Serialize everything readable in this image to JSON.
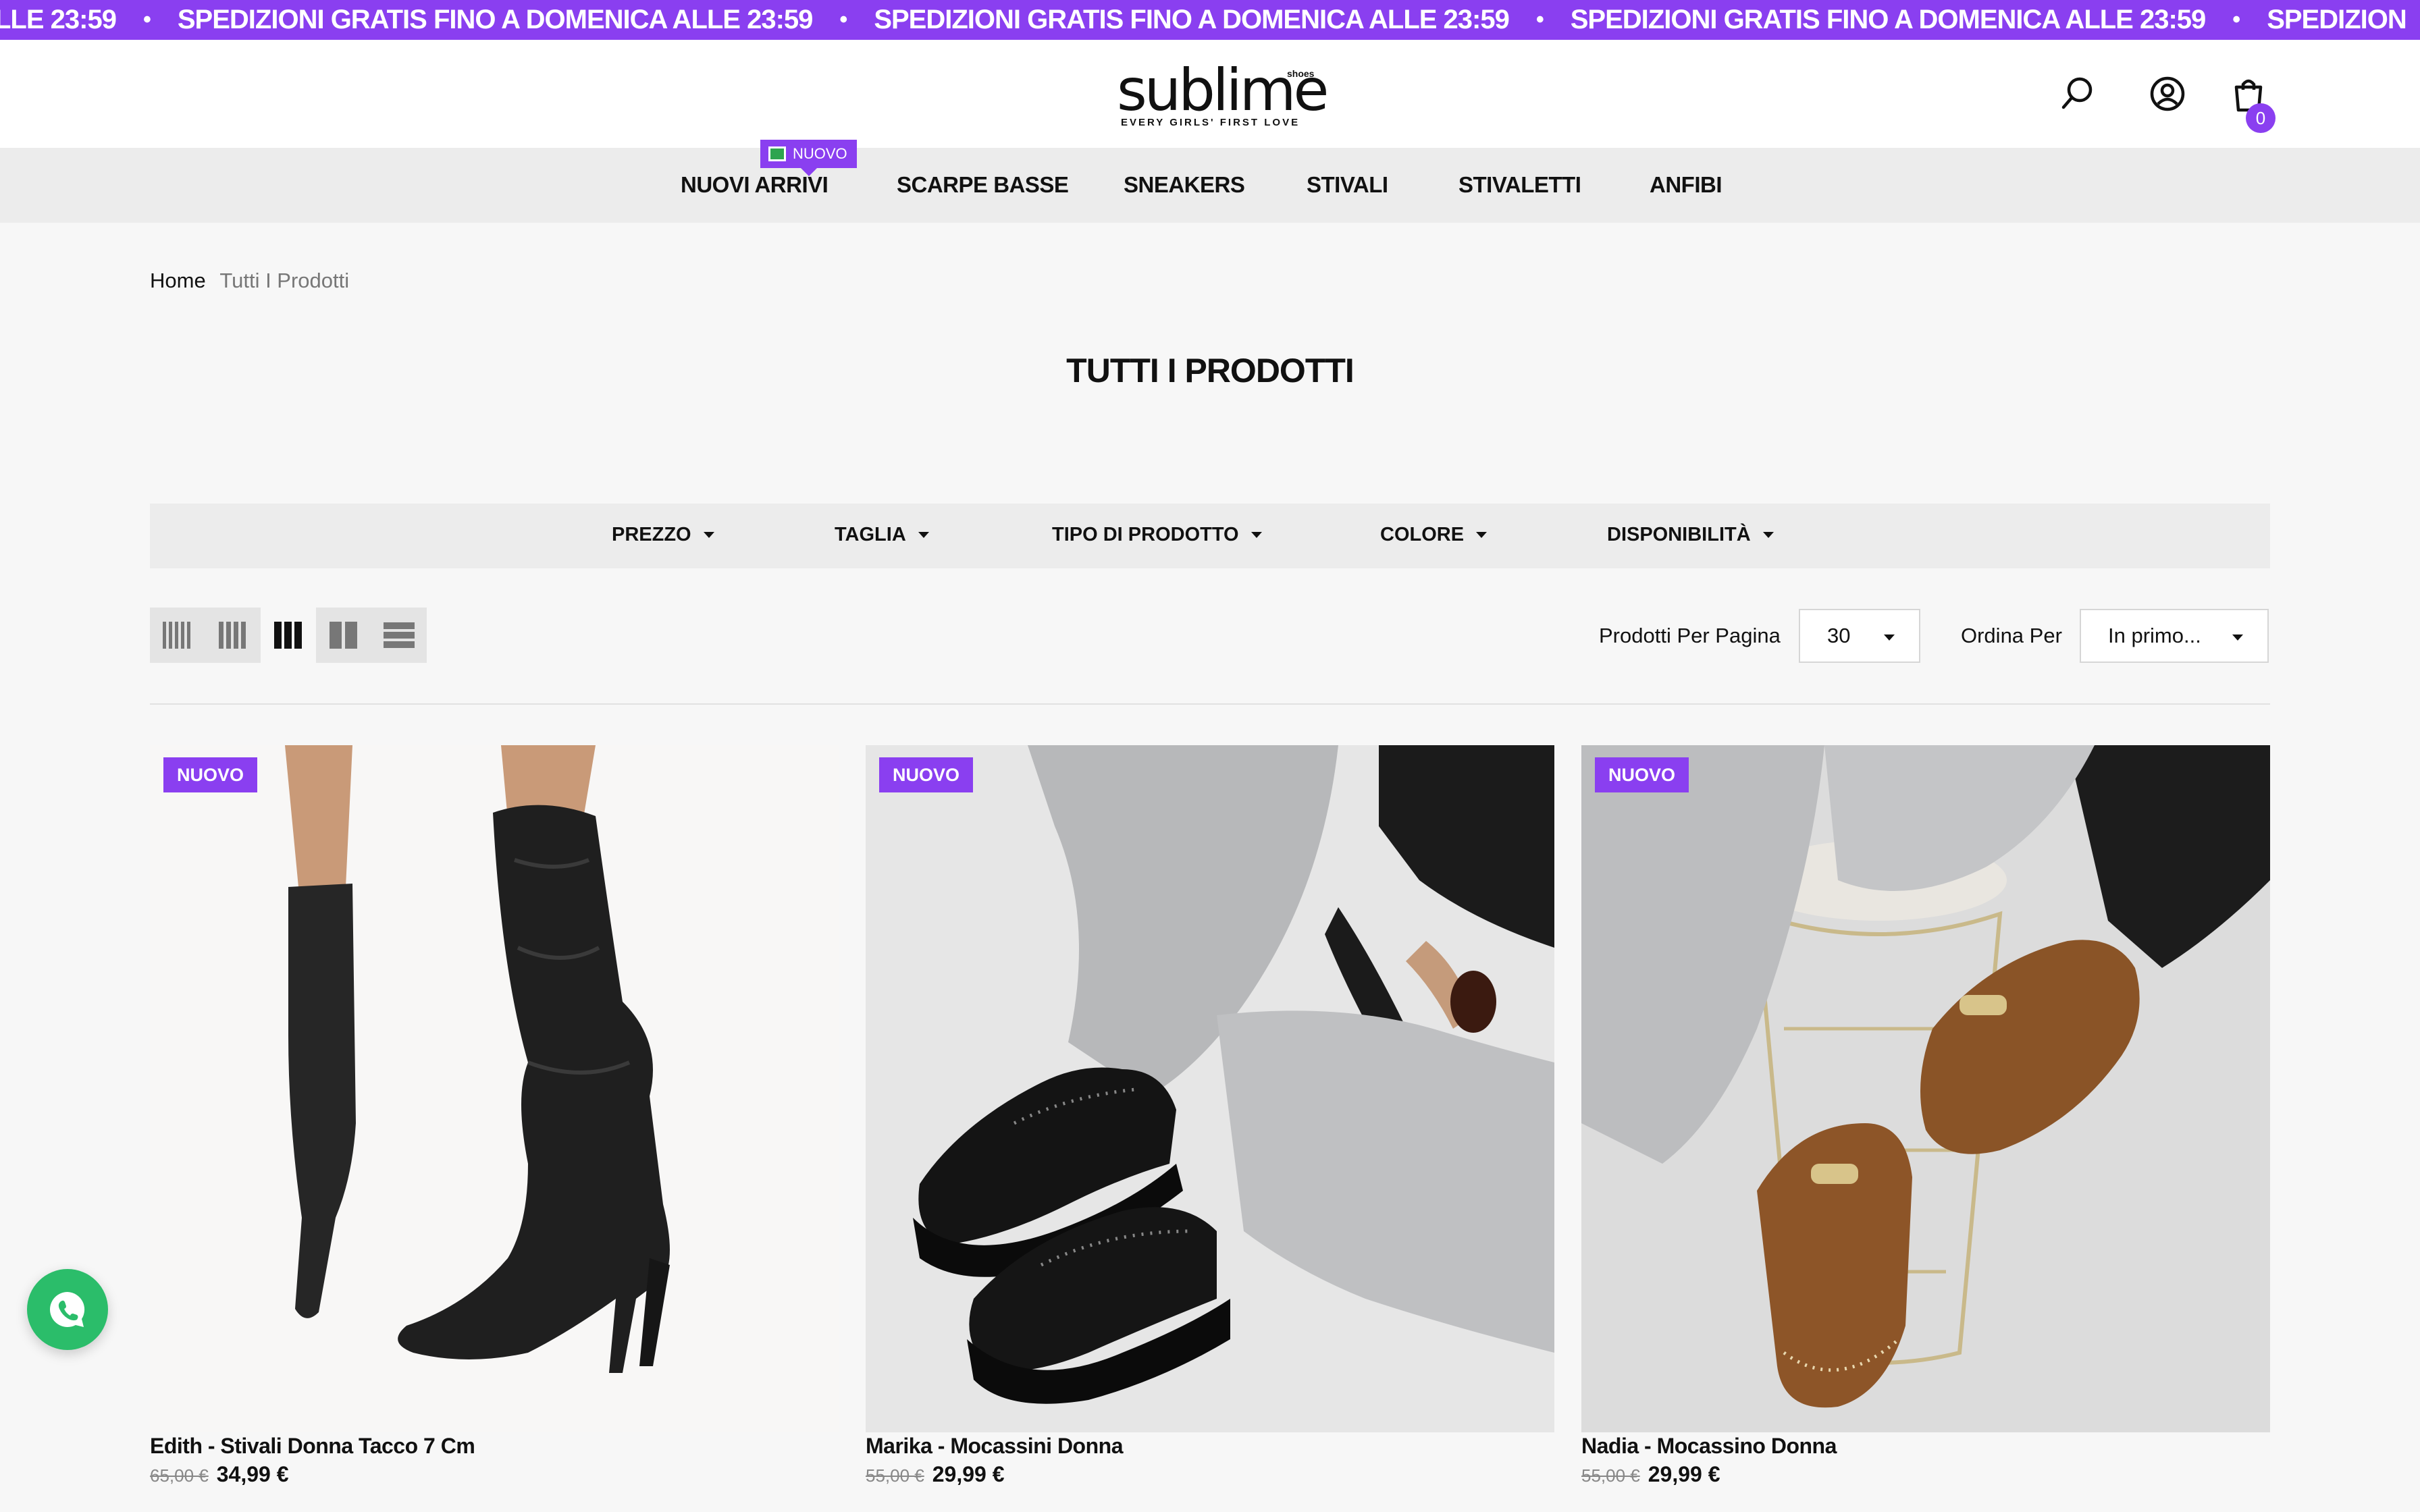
{
  "announcement": {
    "items": [
      "LLE 23:59",
      "SPEDIZIONI GRATIS FINO A DOMENICA ALLE 23:59",
      "SPEDIZIONI GRATIS FINO A DOMENICA ALLE 23:59",
      "SPEDIZIONI GRATIS FINO A DOMENICA ALLE 23:59",
      "SPEDIZION"
    ],
    "separator": "•"
  },
  "header": {
    "logo_text": "sublime",
    "logo_side_text": "shoes",
    "logo_tagline": "EVERY GIRLS' FIRST LOVE",
    "cart_count": "0",
    "icons": [
      "search-icon",
      "account-icon",
      "cart-icon"
    ]
  },
  "nav": {
    "new_badge": "NUOVO",
    "items": [
      "NUOVI ARRIVI",
      "SCARPE BASSE",
      "SNEAKERS",
      "STIVALI",
      "STIVALETTI",
      "ANFIBI"
    ]
  },
  "breadcrumb": {
    "home": "Home",
    "current": "Tutti I Prodotti"
  },
  "page_title": "TUTTI I PRODOTTI",
  "filters": [
    "PREZZO",
    "TAGLIA",
    "TIPO DI PRODOTTO",
    "COLORE",
    "DISPONIBILITÀ"
  ],
  "toolbar": {
    "views": [
      "grid-5-icon",
      "grid-4-icon",
      "grid-3-icon",
      "grid-2-icon",
      "list-icon"
    ],
    "active_view": "grid-3-icon",
    "per_page_label": "Prodotti Per Pagina",
    "per_page_value": "30",
    "sort_label": "Ordina Per",
    "sort_value": "In primo..."
  },
  "products": [
    {
      "badge": "NUOVO",
      "name": "Edith - Stivali Donna Tacco 7 Cm",
      "old_price": "65,00 €",
      "price": "34,99 €"
    },
    {
      "badge": "NUOVO",
      "name": "Marika - Mocassini Donna",
      "old_price": "55,00 €",
      "price": "29,99 €"
    },
    {
      "badge": "NUOVO",
      "name": "Nadia - Mocassino Donna",
      "old_price": "55,00 €",
      "price": "29,99 €"
    }
  ],
  "colors": {
    "accent": "#8a3ff0",
    "whatsapp": "#2bbd6a"
  }
}
